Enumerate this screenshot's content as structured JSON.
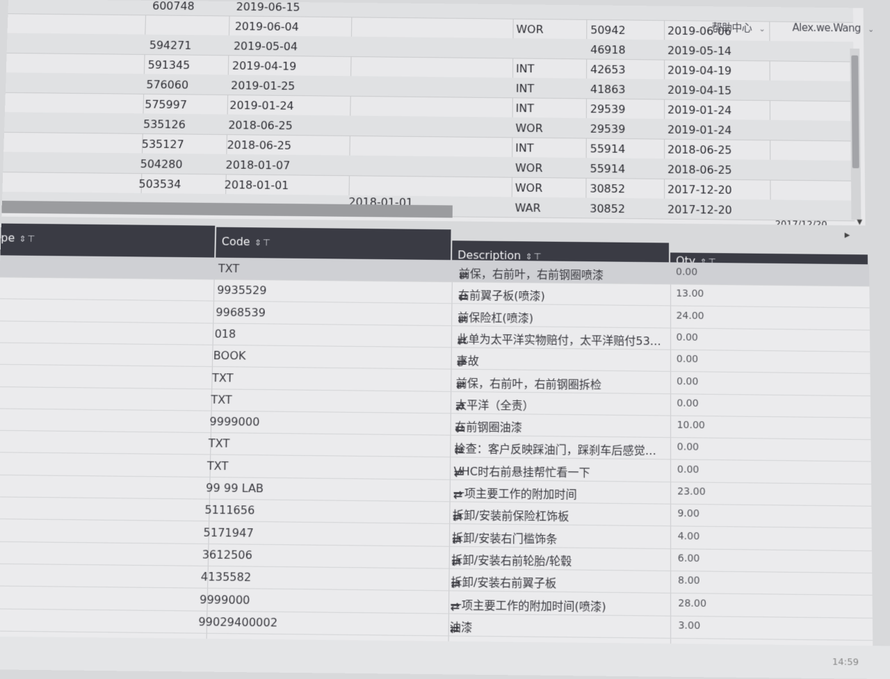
{
  "header": {
    "help_label": "帮助中心",
    "user_name": "Alex.we.Wang"
  },
  "upper_table": {
    "rows": [
      {
        "id": "600748",
        "date": "2019-06-15",
        "type": "",
        "amount": "",
        "date2": ""
      },
      {
        "id": "",
        "date": "2019-06-04",
        "type": "WOR",
        "amount": "50942",
        "date2": "2019-06-06"
      },
      {
        "id": "594271",
        "date": "2019-05-04",
        "type": "",
        "amount": "46918",
        "date2": "2019-05-14"
      },
      {
        "id": "591345",
        "date": "2019-04-19",
        "type": "INT",
        "amount": "42653",
        "date2": "2019-04-19"
      },
      {
        "id": "576060",
        "date": "2019-01-25",
        "type": "INT",
        "amount": "41863",
        "date2": "2019-04-15"
      },
      {
        "id": "575997",
        "date": "2019-01-24",
        "type": "INT",
        "amount": "29539",
        "date2": "2019-01-24"
      },
      {
        "id": "535126",
        "date": "2018-06-25",
        "type": "WOR",
        "amount": "29539",
        "date2": "2019-01-24"
      },
      {
        "id": "535127",
        "date": "2018-06-25",
        "type": "INT",
        "amount": "55914",
        "date2": "2018-06-25"
      },
      {
        "id": "504280",
        "date": "2018-01-07",
        "type": "WOR",
        "amount": "55914",
        "date2": "2018-06-25"
      },
      {
        "id": "503534",
        "date": "2018-01-01",
        "type": "WOR",
        "amount": "30852",
        "date2": "2017-12-20"
      },
      {
        "id": "",
        "date": "",
        "type": "WAR",
        "amount": "30852",
        "date2": "2017-12-20"
      }
    ],
    "extra_date_a": "2018-01-01",
    "extra_date_b": "2017/12/20"
  },
  "lower_table": {
    "headers": {
      "type": "pe",
      "code": "Code",
      "description": "Description",
      "qty": "Qty"
    },
    "rows": [
      {
        "code": "TXT",
        "description": "前保，右前叶，右前钢圈喷漆",
        "qty": "0.00"
      },
      {
        "code": "9935529",
        "description": "右前翼子板(喷漆)",
        "qty": "13.00"
      },
      {
        "code": "9968539",
        "description": "前保险杠(喷漆)",
        "qty": "24.00"
      },
      {
        "code": "018",
        "description": "此单为太平洋实物赔付，太平洋赔付53…",
        "qty": "0.00"
      },
      {
        "code": "BOOK",
        "description": "事故",
        "qty": "0.00"
      },
      {
        "code": "TXT",
        "description": "前保，右前叶，右前钢圈拆检",
        "qty": "0.00"
      },
      {
        "code": "TXT",
        "description": "太平洋（全责）",
        "qty": "0.00"
      },
      {
        "code": "9999000",
        "description": "右前钢圈油漆",
        "qty": "10.00"
      },
      {
        "code": "TXT",
        "description": "检查：客户反映踩油门，踩刹车后感觉…",
        "qty": "0.00"
      },
      {
        "code": "TXT",
        "description": "VHC时右前悬挂帮忙看一下",
        "qty": "0.00"
      },
      {
        "code": "99 99 LAB",
        "description": "一项主要工作的附加时间",
        "qty": "23.00"
      },
      {
        "code": "5111656",
        "description": "拆卸/安装前保险杠饰板",
        "qty": "9.00"
      },
      {
        "code": "5171947",
        "description": "拆卸/安装右门槛饰条",
        "qty": "4.00"
      },
      {
        "code": "3612506",
        "description": "拆卸/安装右前轮胎/轮毂",
        "qty": "6.00"
      },
      {
        "code": "4135582",
        "description": "拆卸/安装右前翼子板",
        "qty": "8.00"
      },
      {
        "code": "9999000",
        "description": "一项主要工作的附加时间(喷漆)",
        "qty": "28.00"
      },
      {
        "code": "99029400002",
        "description": "油漆",
        "qty": "3.00"
      }
    ]
  },
  "clock": "14:59",
  "colors": {
    "header_bg": "#3a3b44",
    "swap_icon": "#2f3fb8"
  }
}
